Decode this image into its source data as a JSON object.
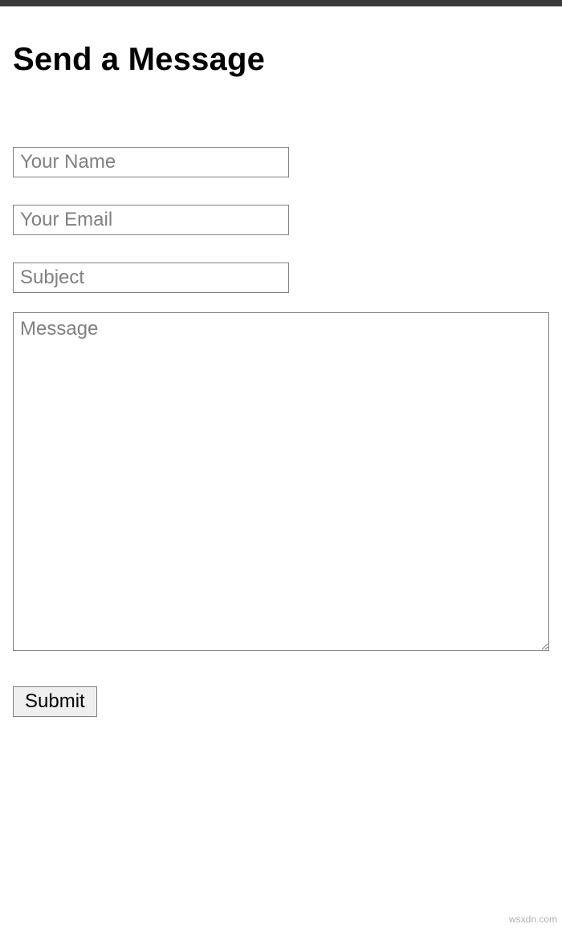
{
  "page": {
    "title": "Send a Message"
  },
  "form": {
    "name": {
      "placeholder": "Your Name",
      "value": ""
    },
    "email": {
      "placeholder": "Your Email",
      "value": ""
    },
    "subject": {
      "placeholder": "Subject",
      "value": ""
    },
    "message": {
      "placeholder": "Message",
      "value": ""
    },
    "submit_label": "Submit"
  },
  "footer": {
    "watermark": "wsxdn.com"
  }
}
